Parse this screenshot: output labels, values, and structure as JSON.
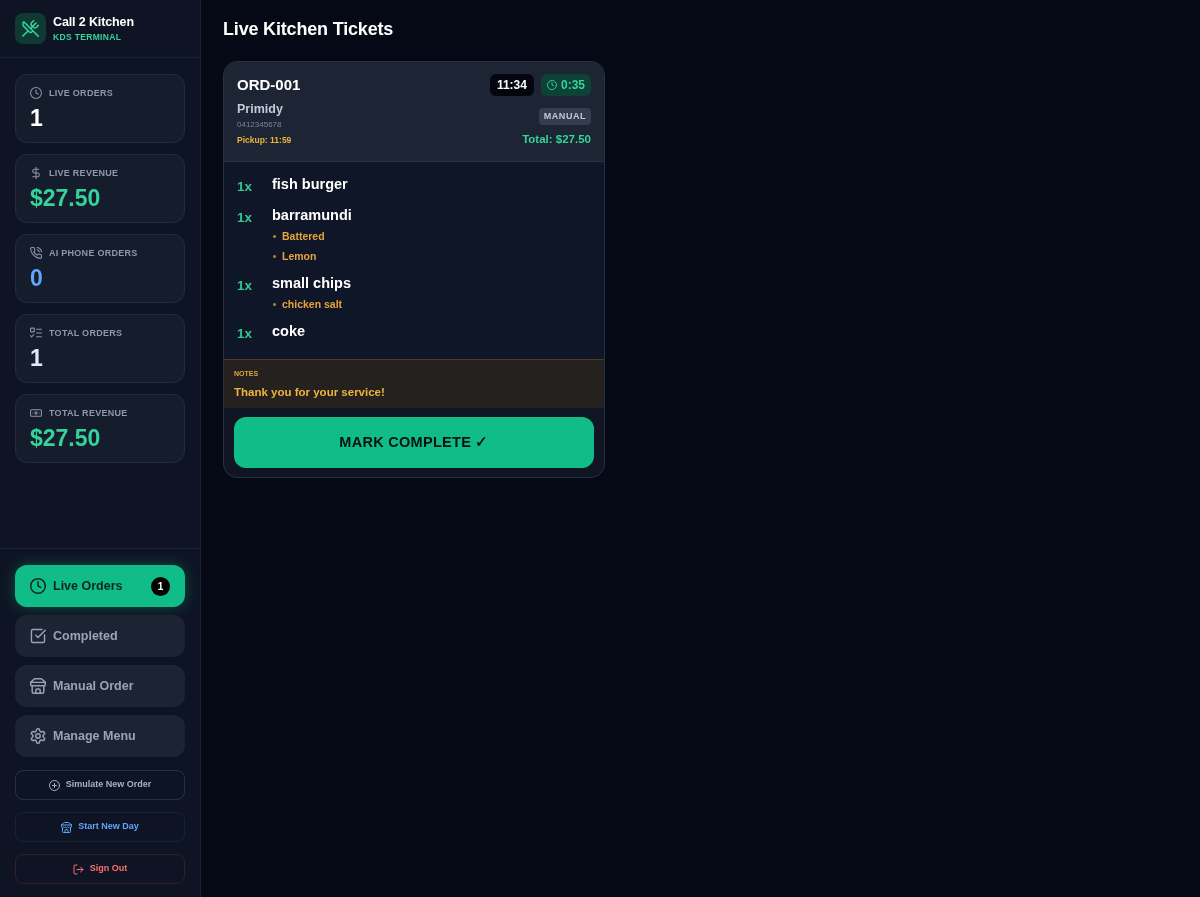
{
  "app": {
    "name": "Call 2 Kitchen",
    "subtitle": "KDS TERMINAL"
  },
  "stats": [
    {
      "label": "LIVE ORDERS",
      "value": "1",
      "color": "#ffffff"
    },
    {
      "label": "LIVE REVENUE",
      "value": "$27.50",
      "color": "#34d399"
    },
    {
      "label": "AI PHONE ORDERS",
      "value": "0",
      "color": "#60a5fa"
    },
    {
      "label": "TOTAL ORDERS",
      "value": "1",
      "color": "#e0e7ff"
    },
    {
      "label": "TOTAL REVENUE",
      "value": "$27.50",
      "color": "#34d399"
    }
  ],
  "nav": [
    {
      "label": "Live Orders",
      "selected": true,
      "badge": "1"
    },
    {
      "label": "Completed",
      "selected": false
    },
    {
      "label": "Manual Order",
      "selected": false
    },
    {
      "label": "Manage Menu",
      "selected": false
    }
  ],
  "actions": [
    {
      "label": "Simulate New Order",
      "kind": "neutral"
    },
    {
      "label": "Start New Day",
      "kind": "info"
    },
    {
      "label": "Sign Out",
      "kind": "danger"
    }
  ],
  "page_title": "Live Kitchen Tickets",
  "tickets": [
    {
      "order_id": "ORD-001",
      "time": "11:34",
      "elapsed": "0:35",
      "customer": "Primidy",
      "phone": "0412345678",
      "pickup": "Pickup: 11:59",
      "source": "MANUAL",
      "total": "Total: $27.50",
      "items": [
        {
          "qty": "1x",
          "name": "fish burger"
        },
        {
          "qty": "1x",
          "name": "barramundi",
          "modifiers": [
            "Battered",
            "Lemon"
          ]
        },
        {
          "qty": "1x",
          "name": "small chips",
          "modifiers": [
            "chicken salt"
          ]
        },
        {
          "qty": "1x",
          "name": "coke"
        }
      ],
      "notes": {
        "label": "NOTES",
        "text": "Thank you for your service!"
      },
      "action": "MARK COMPLETE ✓"
    }
  ]
}
